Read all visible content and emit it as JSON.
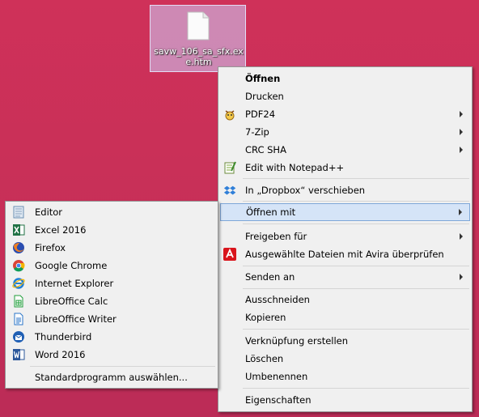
{
  "desktop": {
    "file_name": "savw_106_sa_sfx.exe.htm"
  },
  "context_menu": {
    "open": "Öffnen",
    "print": "Drucken",
    "pdf24": "PDF24",
    "zip": "7-Zip",
    "crc": "CRC SHA",
    "notepad": "Edit with Notepad++",
    "dropbox": "In „Dropbox“ verschieben",
    "open_with": "Öffnen mit",
    "share": "Freigeben für",
    "avira": "Ausgewählte Dateien mit Avira überprüfen",
    "send_to": "Senden an",
    "cut": "Ausschneiden",
    "copy": "Kopieren",
    "shortcut": "Verknüpfung erstellen",
    "delete": "Löschen",
    "rename": "Umbenennen",
    "properties": "Eigenschaften"
  },
  "open_with_menu": {
    "items": [
      {
        "label": "Editor",
        "icon": "notepad-icon"
      },
      {
        "label": "Excel 2016",
        "icon": "excel-icon"
      },
      {
        "label": "Firefox",
        "icon": "firefox-icon"
      },
      {
        "label": "Google Chrome",
        "icon": "chrome-icon"
      },
      {
        "label": "Internet Explorer",
        "icon": "internet-explorer-icon"
      },
      {
        "label": "LibreOffice Calc",
        "icon": "libreoffice-calc-icon"
      },
      {
        "label": "LibreOffice Writer",
        "icon": "libreoffice-writer-icon"
      },
      {
        "label": "Thunderbird",
        "icon": "thunderbird-icon"
      },
      {
        "label": "Word 2016",
        "icon": "word-icon"
      }
    ],
    "choose_default": "Standardprogramm auswählen..."
  },
  "colors": {
    "desktop": "#c8335b",
    "menu_bg": "#f0f0f0",
    "highlight": "#d5e4f7",
    "highlight_border": "#7ea7d8"
  }
}
